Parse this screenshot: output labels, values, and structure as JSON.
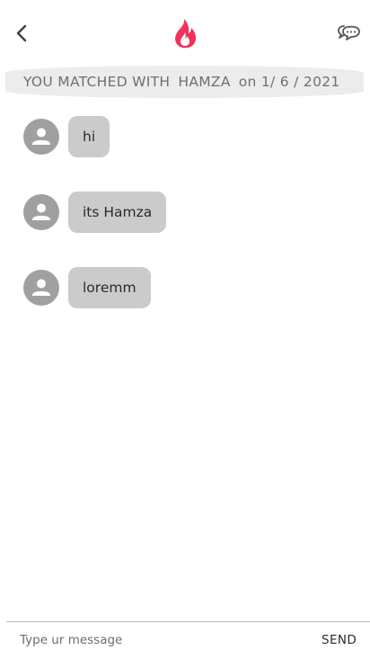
{
  "header": {
    "back_icon": "chevron-left-icon",
    "logo_icon": "flame-logo-icon",
    "chat_icon": "chat-bubbles-icon",
    "brand_color": "#f2325c"
  },
  "match_banner": {
    "prefix": "YOU MATCHED WITH",
    "name": "HAMZA",
    "date": "on 1/ 6 / 2021"
  },
  "messages": [
    {
      "text": "hi"
    },
    {
      "text": "its Hamza"
    },
    {
      "text": "loremm"
    }
  ],
  "composer": {
    "placeholder": "Type ur message",
    "value": "",
    "send_label": "SEND"
  }
}
